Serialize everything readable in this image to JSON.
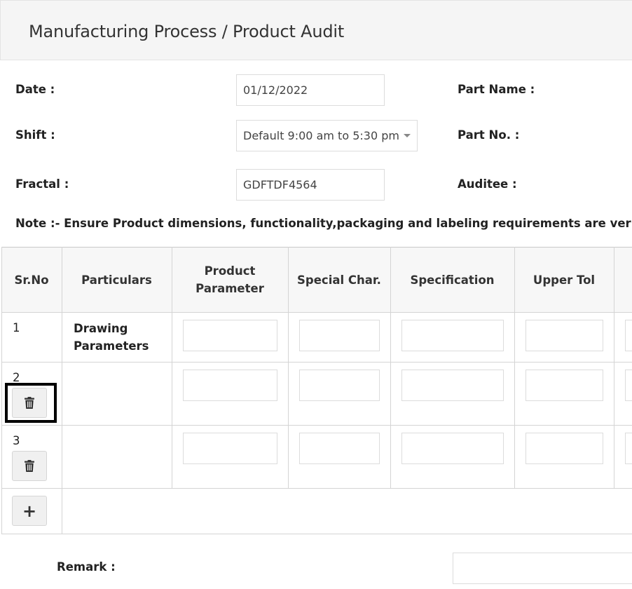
{
  "header": {
    "title": "Manufacturing Process / Product Audit"
  },
  "form": {
    "date_label": "Date :",
    "date_value": "01/12/2022",
    "shift_label": "Shift :",
    "shift_value": "Default 9:00 am to 5:30 pm",
    "fractal_label": "Fractal :",
    "fractal_value": "GDFTDF4564",
    "part_name_label": "Part Name :",
    "part_no_label": "Part No. :",
    "auditee_label": "Auditee :",
    "note": "Note :- Ensure Product dimensions, functionality,packaging and labeling requirements are verified during"
  },
  "table": {
    "headers": {
      "srno": "Sr.No",
      "particulars": "Particulars",
      "product_parameter_line1": "Product",
      "product_parameter_line2": "Parameter",
      "special_char": "Special Char.",
      "specification": "Specification",
      "upper_tol": "Upper Tol"
    },
    "rows": [
      {
        "sr": "1",
        "particulars_line1": "Drawing",
        "particulars_line2": "Parameters"
      },
      {
        "sr": "2"
      },
      {
        "sr": "3"
      }
    ],
    "add_label": "+"
  },
  "remark": {
    "label": "Remark :"
  },
  "icons": {
    "delete": "trash-icon",
    "add": "plus-icon",
    "dropdown": "caret-down-icon"
  }
}
